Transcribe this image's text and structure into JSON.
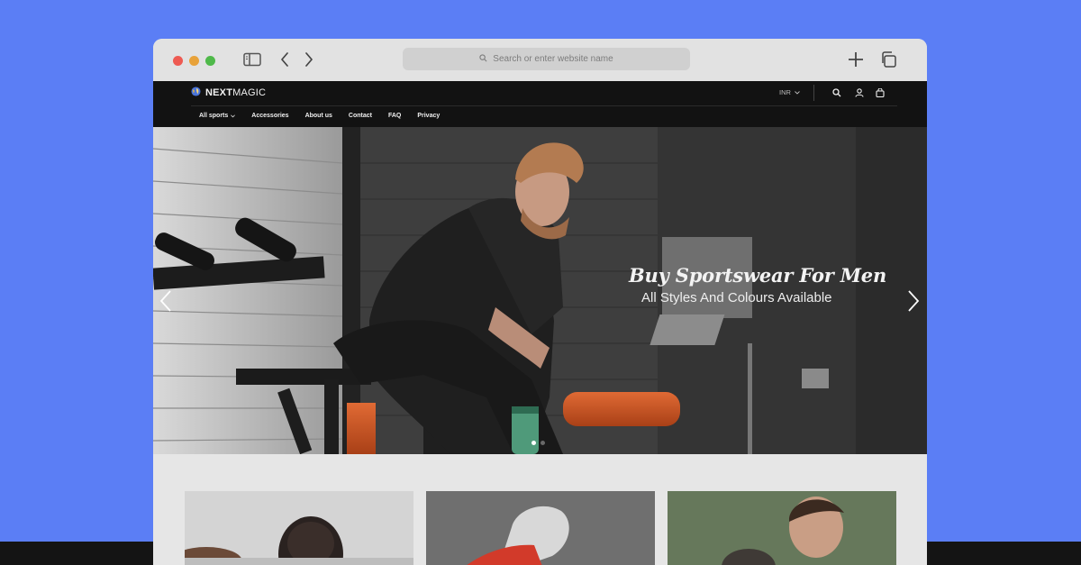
{
  "browser": {
    "url_placeholder": "Search or enter website name",
    "icons": [
      "sidebar-icon",
      "back-icon",
      "forward-icon",
      "search-icon",
      "new-tab-icon",
      "tabs-overview-icon"
    ]
  },
  "site": {
    "logo": {
      "bold": "NEXT",
      "light": "MAGIC"
    },
    "currency": "INR",
    "menu": [
      {
        "label": "All sports",
        "has_dropdown": true
      },
      {
        "label": "Accessories"
      },
      {
        "label": "About us"
      },
      {
        "label": "Contact"
      },
      {
        "label": "FAQ"
      },
      {
        "label": "Privacy"
      }
    ],
    "header_icons": [
      "search-icon",
      "account-icon",
      "cart-icon"
    ]
  },
  "hero": {
    "title": "Buy Sportswear For Men",
    "subtitle": "All Styles And Colours Available",
    "slide_count": 2,
    "active_slide": 1
  },
  "colors": {
    "page_background": "#5b7ef5",
    "site_header": "#121212",
    "accent_orange": "#d65a2a"
  }
}
